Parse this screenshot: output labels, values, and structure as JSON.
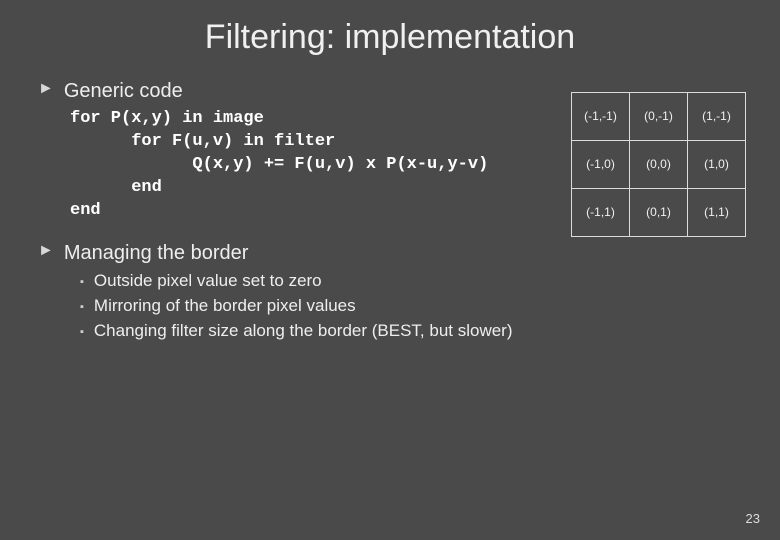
{
  "title": "Filtering: implementation",
  "bullet_glyph": "►",
  "sub_glyph": "▪",
  "sections": {
    "s0": {
      "heading": "Generic code"
    },
    "s1": {
      "heading": "Managing the border"
    }
  },
  "code": {
    "l0": "for P(x,y) in image",
    "l1": "      for F(u,v) in filter",
    "l2": "            Q(x,y) += F(u,v) x P(x-u,y-v)",
    "l3": "      end",
    "l4": "end"
  },
  "sub": {
    "i0": "Outside pixel value set to zero",
    "i1": "Mirroring of the border pixel values",
    "i2": "Changing filter size along the border (BEST, but slower)"
  },
  "grid": {
    "r0c0": "(-1,-1)",
    "r0c1": "(0,-1)",
    "r0c2": "(1,-1)",
    "r1c0": "(-1,0)",
    "r1c1": "(0,0)",
    "r1c2": "(1,0)",
    "r2c0": "(-1,1)",
    "r2c1": "(0,1)",
    "r2c2": "(1,1)"
  },
  "page_number": "23"
}
